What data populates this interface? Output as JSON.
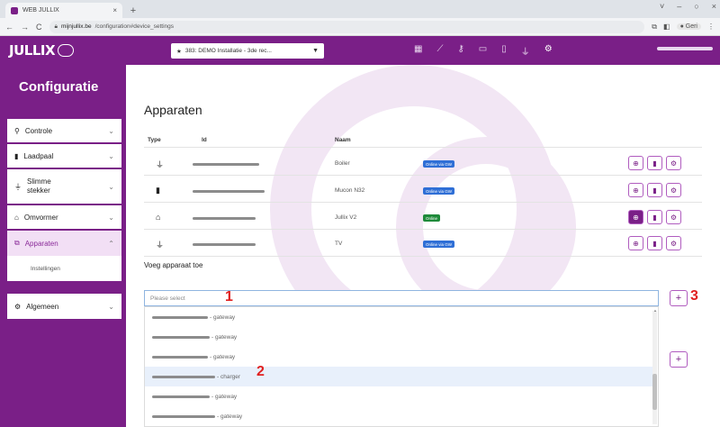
{
  "browser": {
    "tab_title": "WEB JULLIX",
    "tab_close": "×",
    "new_tab": "+",
    "window_controls": [
      "˅",
      "–",
      "○",
      "×"
    ],
    "nav": [
      "←",
      "→",
      "C"
    ],
    "url_host": "mijnjullix.be",
    "url_path": "/configuration#device_settings",
    "profile_label": "Geri"
  },
  "topbar": {
    "logo": "JULLIX",
    "installation_select": "383: DEMO Installatie - 3de rec...",
    "icons": [
      "grid-icon",
      "chart-icon",
      "key-icon",
      "battery-icon",
      "charger-icon",
      "plug-icon",
      "gear-icon"
    ]
  },
  "sidebar": {
    "title": "Configuratie",
    "items": [
      {
        "label": "Controle",
        "icon": "control-icon"
      },
      {
        "label": "Laadpaal",
        "icon": "charger-icon"
      },
      {
        "label": "Slimme stekker",
        "icon": "plug-icon"
      },
      {
        "label": "Omvormer",
        "icon": "inverter-icon"
      },
      {
        "label": "Apparaten",
        "icon": "devices-icon"
      },
      {
        "label": "Algemeen",
        "icon": "gear-icon"
      }
    ],
    "sub_item": "Instellingen"
  },
  "main": {
    "title": "Apparaten",
    "columns": [
      "Type",
      "Id",
      "Naam"
    ],
    "devices": [
      {
        "type_icon": "plug-icon",
        "name": "Boiler",
        "status": "Online via GW",
        "status_color": "#2f6fd6"
      },
      {
        "type_icon": "charger-icon",
        "name": "Mucon N32",
        "status": "Online via GW",
        "status_color": "#2f6fd6"
      },
      {
        "type_icon": "inverter-icon",
        "name": "Jullix V2",
        "status": "Online",
        "status_color": "#1f8a3a"
      },
      {
        "type_icon": "plug-icon",
        "name": "TV",
        "status": "Online via GW",
        "status_color": "#2f6fd6"
      }
    ],
    "add_label": "Voeg apparaat toe",
    "select_placeholder": "Please select",
    "options": [
      {
        "suffix": " - gateway"
      },
      {
        "suffix": " - gateway"
      },
      {
        "suffix": " - gateway"
      },
      {
        "suffix": " - charger"
      },
      {
        "suffix": " - gateway"
      },
      {
        "suffix": " - gateway"
      }
    ]
  },
  "annotations": [
    "1",
    "2",
    "3"
  ],
  "colors": {
    "brand": "#7a1f87",
    "accent_light": "#f2dff5"
  }
}
